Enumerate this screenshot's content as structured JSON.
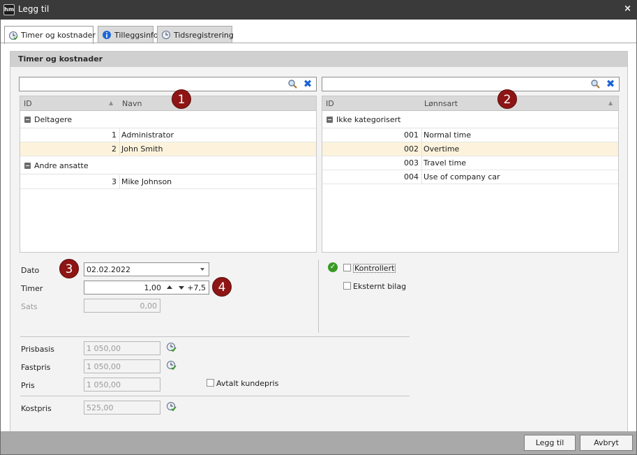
{
  "window": {
    "logo": "hm",
    "title": "Legg til",
    "close_glyph": "×"
  },
  "tabs": [
    {
      "label": "Timer og kostnader",
      "icon": "clock-check-icon",
      "active": true
    },
    {
      "label": "Tilleggsinfo",
      "icon": "info-icon",
      "active": false
    },
    {
      "label": "Tidsregistrering",
      "icon": "clock-icon",
      "active": false
    }
  ],
  "panel": {
    "title": "Timer og kostnader"
  },
  "left_grid": {
    "search_value": "",
    "col_id": "ID",
    "col_name": "Navn",
    "groups": [
      {
        "label": "Deltagere",
        "rows": [
          {
            "id": "1",
            "name": "Administrator"
          },
          {
            "id": "2",
            "name": "John Smith"
          }
        ]
      },
      {
        "label": "Andre ansatte",
        "rows": [
          {
            "id": "3",
            "name": "Mike Johnson"
          }
        ]
      }
    ]
  },
  "right_grid": {
    "search_value": "",
    "col_id": "ID",
    "col_name": "Lønnsart",
    "groups": [
      {
        "label": "Ikke kategorisert",
        "rows": [
          {
            "id": "001",
            "name": "Normal time"
          },
          {
            "id": "002",
            "name": "Overtime"
          },
          {
            "id": "003",
            "name": "Travel time"
          },
          {
            "id": "004",
            "name": "Use of company car"
          }
        ]
      }
    ]
  },
  "badges": [
    "1",
    "2",
    "3",
    "4"
  ],
  "form": {
    "dato_label": "Dato",
    "dato_value": "02.02.2022",
    "timer_label": "Timer",
    "timer_value": "1,00",
    "timer_step": "+7,5",
    "sats_label": "Sats",
    "sats_value": "0,00",
    "kontrollert_label": "Kontrollert",
    "eksternt_label": "Eksternt bilag",
    "prisbasis_label": "Prisbasis",
    "prisbasis_value": "1 050,00",
    "fastpris_label": "Fastpris",
    "fastpris_value": "1 050,00",
    "pris_label": "Pris",
    "pris_value": "1 050,00",
    "avtalt_label": "Avtalt kundepris",
    "kostpris_label": "Kostpris",
    "kostpris_value": "525,00"
  },
  "buttons": {
    "add": "Legg til",
    "cancel": "Avbryt"
  },
  "colors": {
    "badge": "#8e1515",
    "selected_row": "#fdf3dc",
    "clear_icon": "#1b63d3"
  }
}
